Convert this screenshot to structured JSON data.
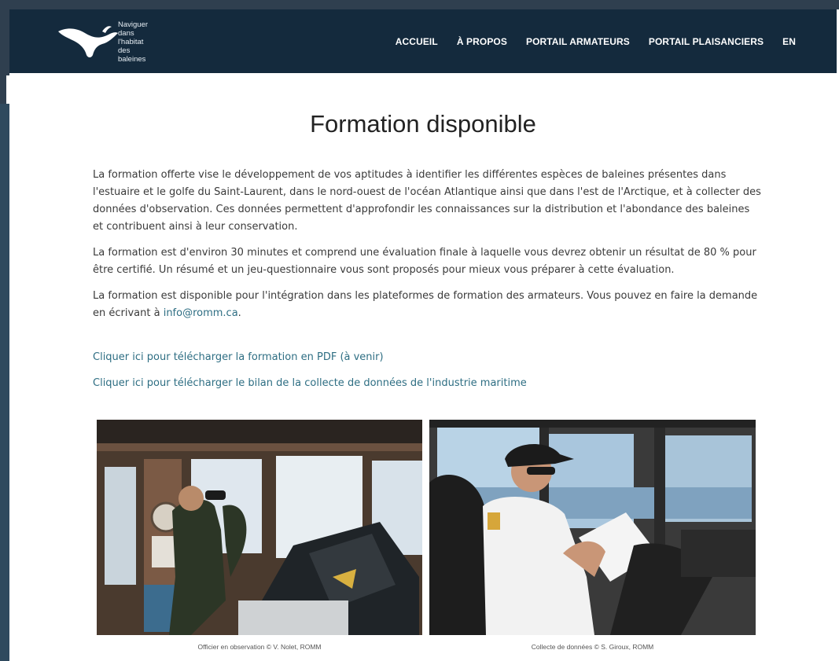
{
  "header": {
    "logo": {
      "line1": "Naviguer",
      "line2": "dans l'habitat",
      "line3": "des baleines",
      "icon": "whale-tail-icon"
    },
    "nav": [
      {
        "label": "ACCUEIL"
      },
      {
        "label": "À PROPOS"
      },
      {
        "label": "PORTAIL ARMATEURS"
      },
      {
        "label": "PORTAIL PLAISANCIERS"
      },
      {
        "label": "EN"
      }
    ],
    "background": "#142a3d"
  },
  "main": {
    "title": "Formation disponible",
    "paragraphs": [
      "La formation offerte vise le développement de vos aptitudes à identifier les différentes espèces de baleines présentes dans l'estuaire et le golfe du Saint-Laurent, dans le nord-ouest de l'océan Atlantique ainsi que dans l'est de l'Arctique, et à collecter des données d'observation. Ces données permettent d'approfondir les connaissances sur la distribution et l'abondance des baleines et contribuent ainsi à leur conservation.",
      "La formation est d'environ 30 minutes et comprend une évaluation finale à laquelle vous devrez obtenir un résultat de 80 % pour être certifié. Un résumé et un jeu-questionnaire vous sont proposés pour mieux vous préparer à cette évaluation."
    ],
    "contact": {
      "text_before": "La formation est disponible pour l'intégration dans les plateformes de formation des armateurs. Vous pouvez en faire la demande en écrivant à ",
      "email": "info@romm.ca",
      "text_after": "."
    },
    "links": [
      {
        "label": "Cliquer ici pour télécharger la formation en PDF (à venir)"
      },
      {
        "label": "Cliquer ici pour télécharger le bilan de la collecte de données de l'industrie maritime"
      }
    ],
    "link_color": "#2e6e83"
  },
  "photos": [
    {
      "caption": "Officier en observation © V. Nolet, ROMM"
    },
    {
      "caption": "Collecte de données © S. Giroux, ROMM"
    }
  ]
}
